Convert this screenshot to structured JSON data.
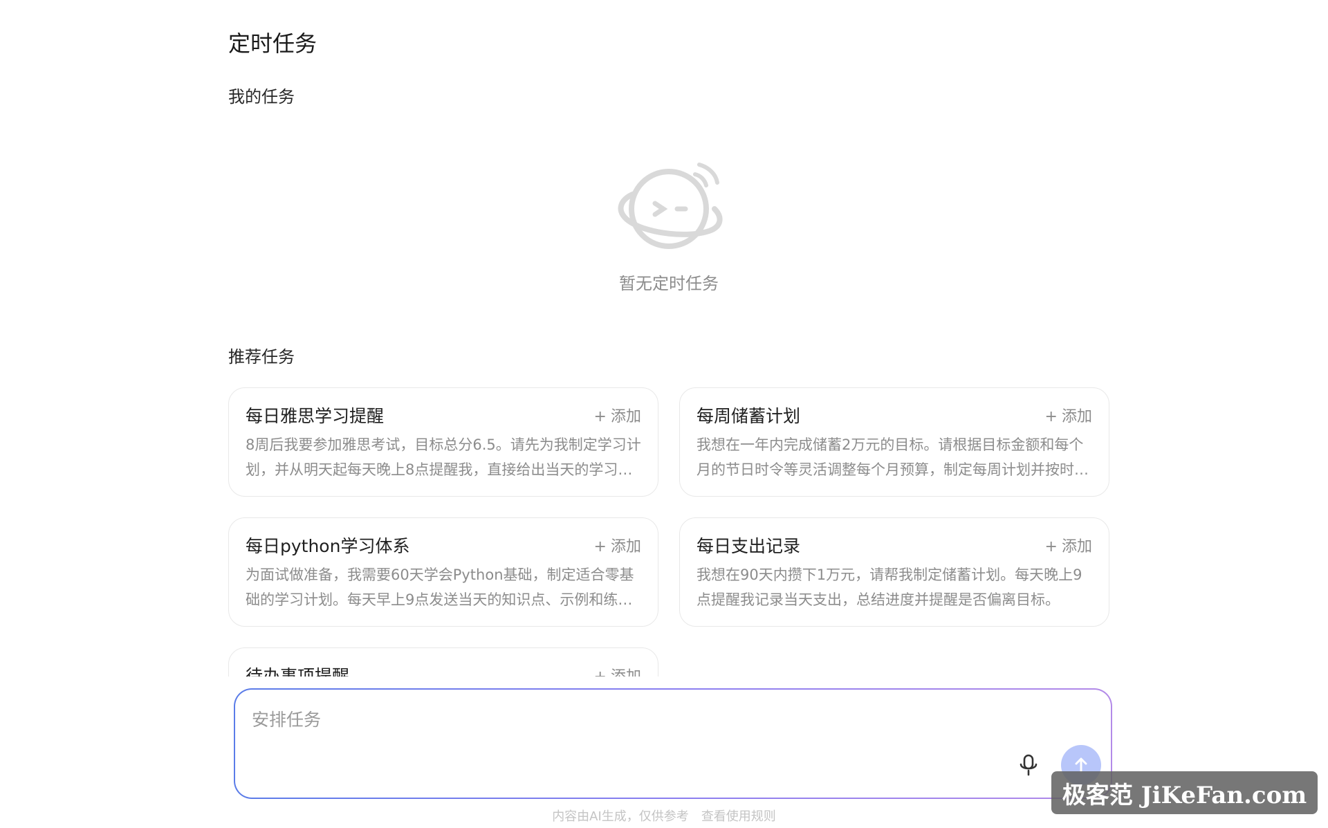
{
  "page": {
    "title": "定时任务"
  },
  "my_tasks": {
    "heading": "我的任务",
    "empty_icon": "planet-face-icon",
    "empty_text": "暂无定时任务"
  },
  "recommended": {
    "heading": "推荐任务",
    "add_label": "添加",
    "add_icon": "plus-icon",
    "cards": [
      {
        "title": "每日雅思学习提醒",
        "desc": "8周后我要参加雅思考试，目标总分6.5。请先为我制定学习计划，并从明天起每天晚上8点提醒我，直接给出当天的学习任务。"
      },
      {
        "title": "每周储蓄计划",
        "desc": "我想在一年内完成储蓄2万元的目标。请根据目标金额和每个月的节日时令等灵活调整每个月预算，制定每周计划并按时提醒我。"
      },
      {
        "title": "每日python学习体系",
        "desc": "为面试做准备，我需要60天学会Python基础，制定适合零基础的学习计划。每天早上9点发送当天的知识点、示例和练习题。"
      },
      {
        "title": "每日支出记录",
        "desc": "我想在90天内攒下1万元，请帮我制定储蓄计划。每天晚上9点提醒我记录当天支出，总结进度并提醒是否偏离目标。"
      },
      {
        "title": "待办事项提醒",
        "desc": ""
      }
    ]
  },
  "composer": {
    "placeholder": "安排任务",
    "mic_icon": "microphone-icon",
    "send_icon": "arrow-up-icon",
    "accent_color": "#8a7ef0",
    "send_color": "#b8c6fa"
  },
  "footer": {
    "disclaimer": "内容由AI生成，仅供参考",
    "rules_link": "查看使用规则"
  },
  "watermark": {
    "text": "极客范 JiKeFan.com"
  }
}
